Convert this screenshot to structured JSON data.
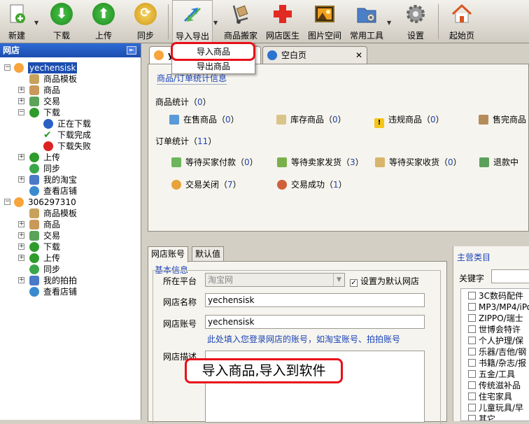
{
  "toolbar": {
    "items": [
      {
        "label": "新建",
        "icon": "new-document-icon"
      },
      {
        "label": "下载",
        "icon": "download-icon"
      },
      {
        "label": "上传",
        "icon": "upload-icon"
      },
      {
        "label": "同步",
        "icon": "sync-icon"
      },
      {
        "label": "导入导出",
        "icon": "import-export-icon"
      },
      {
        "label": "商品搬家",
        "icon": "hand-truck-icon"
      },
      {
        "label": "网店医生",
        "icon": "medical-cross-icon"
      },
      {
        "label": "图片空间",
        "icon": "picture-icon"
      },
      {
        "label": "常用工具",
        "icon": "tools-folder-icon"
      },
      {
        "label": "设置",
        "icon": "gear-icon"
      },
      {
        "label": "起始页",
        "icon": "home-icon"
      }
    ]
  },
  "sidebar": {
    "title": "网店",
    "store1": {
      "name": "yechensisk",
      "children": [
        "商品模板",
        "商品",
        "交易",
        "下载",
        "正在下载",
        "下载完成",
        "下载失败",
        "上传",
        "同步",
        "我的淘宝",
        "查看店铺"
      ]
    },
    "store2": {
      "name": "306297310",
      "children": [
        "商品模板",
        "商品",
        "交易",
        "下载",
        "上传",
        "同步",
        "我的拍拍",
        "查看店铺"
      ]
    }
  },
  "tabs": [
    {
      "label": "y"
    },
    {
      "label": "空白页"
    }
  ],
  "dropdown": {
    "import": "导入商品",
    "export": "导出商品"
  },
  "stats": {
    "section_title": "商品/订单统计信息",
    "goods_label": "商品统计",
    "goods_count": "0",
    "on_sale": {
      "label": "在售商品",
      "value": "0"
    },
    "stock": {
      "label": "库存商品",
      "value": "0"
    },
    "violation": {
      "label": "违规商品",
      "value": "0"
    },
    "sold_out": {
      "label": "售完商品"
    },
    "orders_label": "订单统计",
    "orders_count": "11",
    "wait_pay": {
      "label": "等待买家付款",
      "value": "0"
    },
    "wait_ship": {
      "label": "等待卖家发货",
      "value": "3"
    },
    "wait_receive": {
      "label": "等待买家收货",
      "value": "0"
    },
    "refunding": {
      "label": "退款中"
    },
    "closed": {
      "label": "交易关闭",
      "value": "7"
    },
    "success": {
      "label": "交易成功",
      "value": "1"
    }
  },
  "account": {
    "tab1": "网店账号",
    "tab2": "默认值",
    "group": "基本信息",
    "platform_label": "所在平台",
    "platform_value": "淘宝网",
    "default_label": "设置为默认网店",
    "name_label": "网店名称",
    "name_value": "yechensisk",
    "account_label": "网店账号",
    "account_value": "yechensisk",
    "hint": "此处填入您登录网店的账号，如淘宝账号、拍拍账号",
    "desc_label": "网店描述"
  },
  "categories": {
    "title": "主营类目",
    "keyword_label": "关键字",
    "items": [
      "3C数码配件",
      "MP3/MP4/iPo",
      "ZIPPO/瑞士",
      "世博会特许",
      "个人护理/保",
      "乐器/吉他/钢",
      "书籍/杂志/报",
      "五金/工具",
      "传统滋补品",
      "住宅家具",
      "儿童玩具/早",
      "其它"
    ]
  },
  "callout": "导入商品,导入到软件"
}
